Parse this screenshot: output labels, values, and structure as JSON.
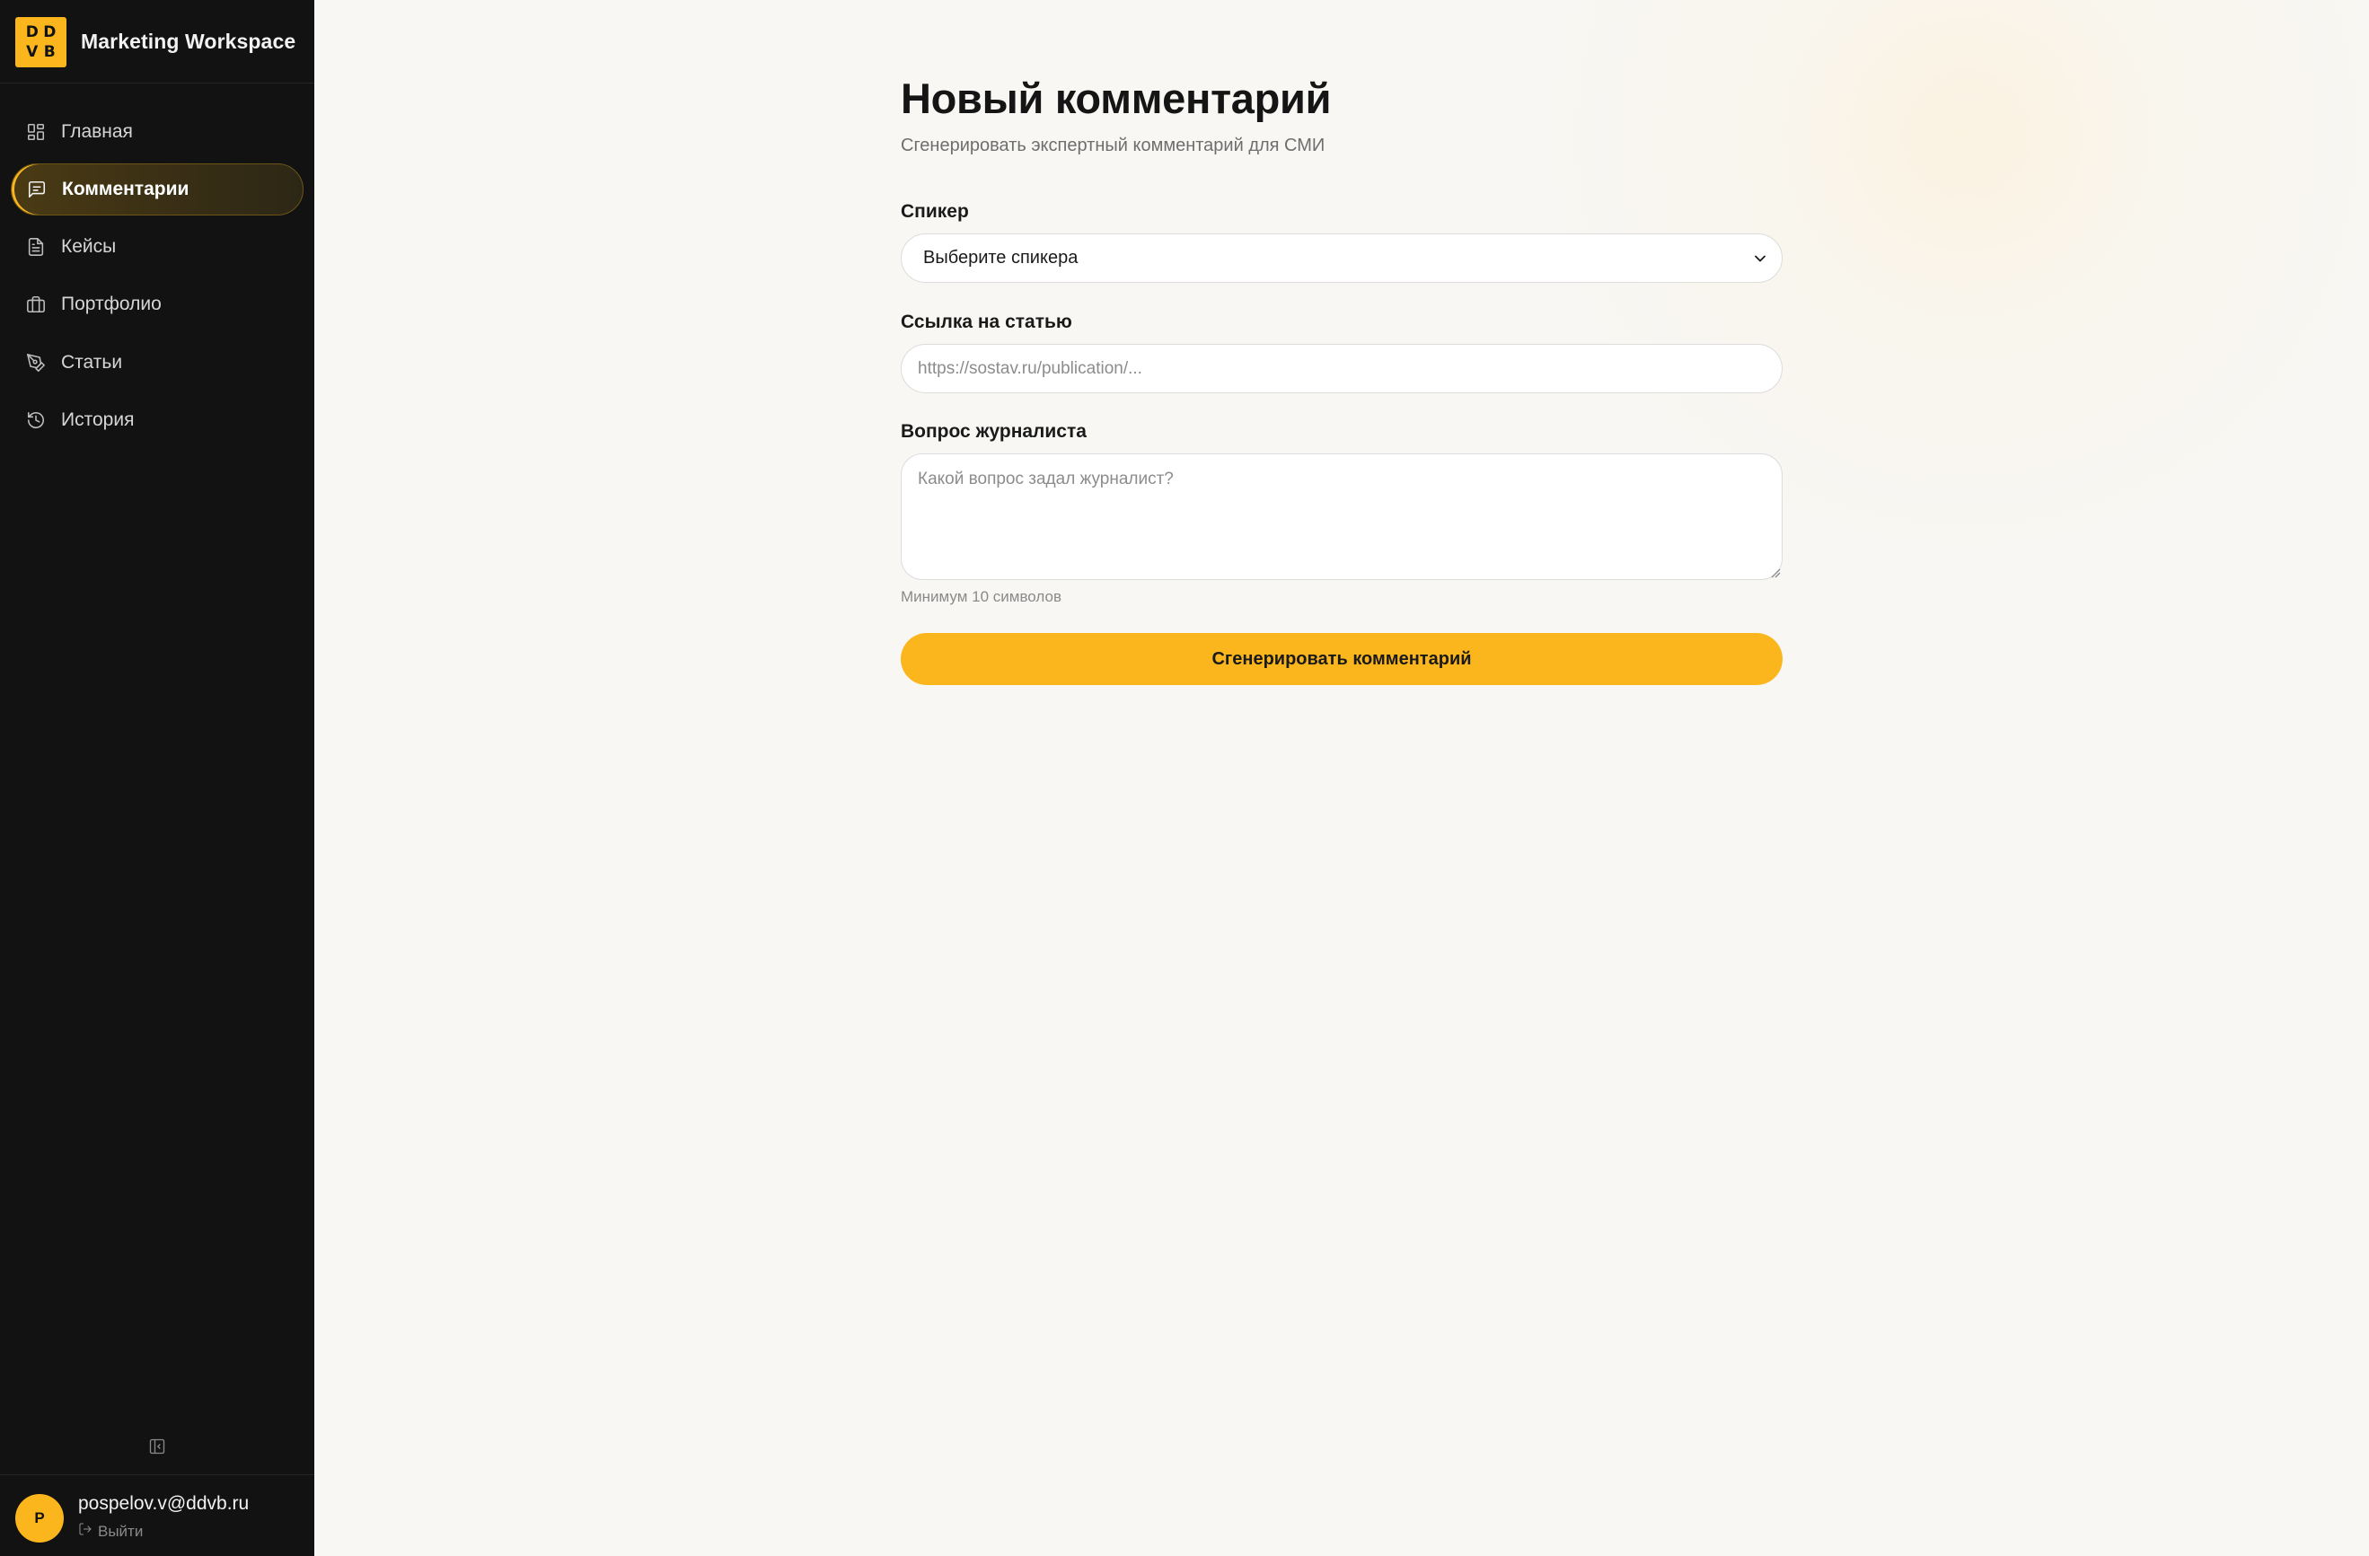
{
  "app": {
    "logo_letters": [
      "D",
      "D",
      "V",
      "B"
    ],
    "title": "Marketing Workspace"
  },
  "sidebar": {
    "items": [
      {
        "label": "Главная",
        "icon": "grid-icon",
        "active": false
      },
      {
        "label": "Комментарии",
        "icon": "message-square-icon",
        "active": true
      },
      {
        "label": "Кейсы",
        "icon": "file-text-icon",
        "active": false
      },
      {
        "label": "Портфолио",
        "icon": "briefcase-icon",
        "active": false
      },
      {
        "label": "Статьи",
        "icon": "pen-tool-icon",
        "active": false
      },
      {
        "label": "История",
        "icon": "history-icon",
        "active": false
      }
    ],
    "collapse_icon": "panel-collapse-icon"
  },
  "user": {
    "avatar_initial": "P",
    "email": "pospelov.v@ddvb.ru",
    "logout_label": "Выйти"
  },
  "page": {
    "title": "Новый комментарий",
    "subtitle": "Сгенерировать экспертный комментарий для СМИ"
  },
  "form": {
    "speaker": {
      "label": "Спикер",
      "selected": "Выберите спикера"
    },
    "article_link": {
      "label": "Ссылка на статью",
      "value": "",
      "placeholder": "https://sostav.ru/publication/..."
    },
    "question": {
      "label": "Вопрос журналиста",
      "value": "",
      "placeholder": "Какой вопрос задал журналист?",
      "hint": "Минимум 10 символов"
    },
    "submit_label": "Сгенерировать комментарий"
  },
  "colors": {
    "accent": "#fbb61d",
    "sidebar_bg": "#121212",
    "main_bg": "#f8f7f4"
  }
}
